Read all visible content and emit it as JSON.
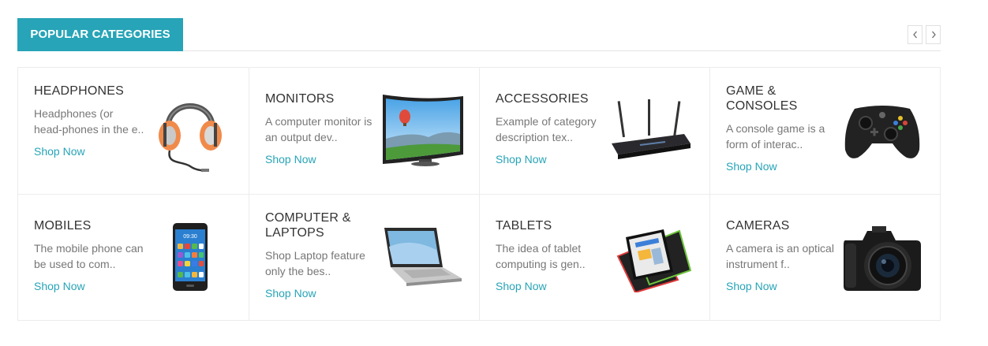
{
  "header": {
    "title": "POPULAR CATEGORIES",
    "prev_icon": "chevron-left-icon",
    "next_icon": "chevron-right-icon"
  },
  "colors": {
    "accent": "#27a4b7",
    "title_text": "#333333",
    "desc_text": "#777777"
  },
  "categories": [
    {
      "title": "HEADPHONES",
      "desc": "Headphones (or head-phones in the e..",
      "link": "Shop Now",
      "image": "headphones-image"
    },
    {
      "title": "MONITORS",
      "desc": "A computer monitor is an output dev..",
      "link": "Shop Now",
      "image": "monitor-image"
    },
    {
      "title": "ACCESSORIES",
      "desc": "Example of category description tex..",
      "link": "Shop Now",
      "image": "router-image"
    },
    {
      "title": "GAME & CONSOLES",
      "desc": "A console game is a form of interac..",
      "link": "Shop Now",
      "image": "gamepad-image"
    },
    {
      "title": "MOBILES",
      "desc": "The mobile phone can be used to com..",
      "link": "Shop Now",
      "image": "smartphone-image"
    },
    {
      "title": "COMPUTER & LAPTOPS",
      "desc": "Shop Laptop feature only the bes..",
      "link": "Shop Now",
      "image": "laptop-image"
    },
    {
      "title": "TABLETS",
      "desc": "The idea of tablet computing is gen..",
      "link": "Shop Now",
      "image": "tablet-image"
    },
    {
      "title": "CAMERAS",
      "desc": "A camera is an optical instrument f..",
      "link": "Shop Now",
      "image": "camera-image"
    }
  ]
}
